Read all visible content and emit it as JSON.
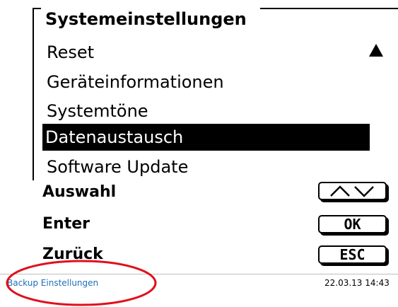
{
  "screen": {
    "title": "Systemeinstellungen"
  },
  "menu": {
    "items": [
      {
        "label": "Reset"
      },
      {
        "label": "Geräteinformationen"
      },
      {
        "label": "Systemtöne"
      },
      {
        "label": "Datenaustausch",
        "selected": true
      },
      {
        "label": "Software Update"
      }
    ]
  },
  "actions": [
    {
      "label": "Auswahl",
      "key_icon": "up-down-arrows-icon"
    },
    {
      "label": "Enter",
      "key": "OK"
    },
    {
      "label": "Zurück",
      "key": "ESC"
    }
  ],
  "status_bar": {
    "left_text": "Backup Einstellungen",
    "datetime": "22.03.13 14:43"
  },
  "colors": {
    "status_link": "#1e6fb8",
    "annotation": "#e0101b",
    "selection_bg": "#000000"
  }
}
